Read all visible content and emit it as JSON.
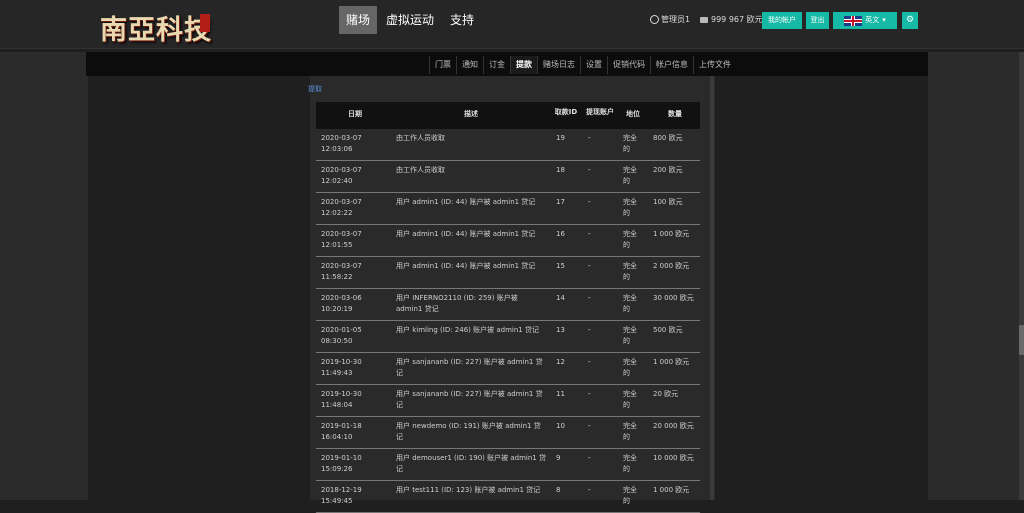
{
  "header": {
    "logo_text": "南亞科技",
    "nav": [
      "赌场",
      "虚拟运动",
      "支持"
    ],
    "active_nav": 0,
    "user_label": "管理员1",
    "balance": "999 967 欧元",
    "my_account_label": "我的帐户",
    "logout_label": "登出",
    "language_label": "英文"
  },
  "subnav": {
    "items": [
      "门票",
      "通知",
      "订金",
      "提款",
      "赌场日志",
      "设置",
      "促销代码",
      "帐户信息",
      "上传文件"
    ],
    "active": 3
  },
  "breadcrumb": "提取",
  "table": {
    "headers": {
      "date": "日期",
      "desc": "描述",
      "id": "取款ID",
      "account": "提现账户",
      "status": "地位",
      "amount": "数量"
    },
    "rows": [
      {
        "date": "2020-03-07 12:03:06",
        "desc": "由工作人员收取",
        "id": "19",
        "account": "-",
        "status": "完全的",
        "amount": "800 欧元"
      },
      {
        "date": "2020-03-07 12:02:40",
        "desc": "由工作人员收取",
        "id": "18",
        "account": "-",
        "status": "完全的",
        "amount": "200 欧元"
      },
      {
        "date": "2020-03-07 12:02:22",
        "desc": "用户 admin1 (ID: 44) 账户被 admin1 贷记",
        "id": "17",
        "account": "-",
        "status": "完全的",
        "amount": "100 欧元"
      },
      {
        "date": "2020-03-07 12:01:55",
        "desc": "用户 admin1 (ID: 44) 账户被 admin1 贷记",
        "id": "16",
        "account": "-",
        "status": "完全的",
        "amount": "1 000 欧元"
      },
      {
        "date": "2020-03-07 11:58:22",
        "desc": "用户 admin1 (ID: 44) 账户被 admin1 贷记",
        "id": "15",
        "account": "-",
        "status": "完全的",
        "amount": "2 000 欧元"
      },
      {
        "date": "2020-03-06 10:20:19",
        "desc": "用户 INFERNO2110 (ID: 259) 账户被 admin1 贷记",
        "id": "14",
        "account": "-",
        "status": "完全的",
        "amount": "30 000 欧元"
      },
      {
        "date": "2020-01-05 08:30:50",
        "desc": "用户 kimling (ID: 246) 账户被 admin1 贷记",
        "id": "13",
        "account": "-",
        "status": "完全的",
        "amount": "500 欧元"
      },
      {
        "date": "2019-10-30 11:49:43",
        "desc": "用户 sanjananb (ID: 227) 账户被 admin1 贷记",
        "id": "12",
        "account": "-",
        "status": "完全的",
        "amount": "1 000 欧元"
      },
      {
        "date": "2019-10-30 11:48:04",
        "desc": "用户 sanjananb (ID: 227) 账户被 admin1 贷记",
        "id": "11",
        "account": "-",
        "status": "完全的",
        "amount": "20 欧元"
      },
      {
        "date": "2019-01-18 16:04:10",
        "desc": "用户 newdemo (ID: 191) 账户被 admin1 贷记",
        "id": "10",
        "account": "-",
        "status": "完全的",
        "amount": "20 000 欧元"
      },
      {
        "date": "2019-01-10 15:09:26",
        "desc": "用户 demouser1 (ID: 190) 账户被 admin1 贷记",
        "id": "9",
        "account": "-",
        "status": "完全的",
        "amount": "10 000 欧元"
      },
      {
        "date": "2018-12-19 15:49:45",
        "desc": "用户 test111 (ID: 123) 账户被 admin1 贷记",
        "id": "8",
        "account": "-",
        "status": "完全的",
        "amount": "1 000 欧元"
      }
    ]
  }
}
